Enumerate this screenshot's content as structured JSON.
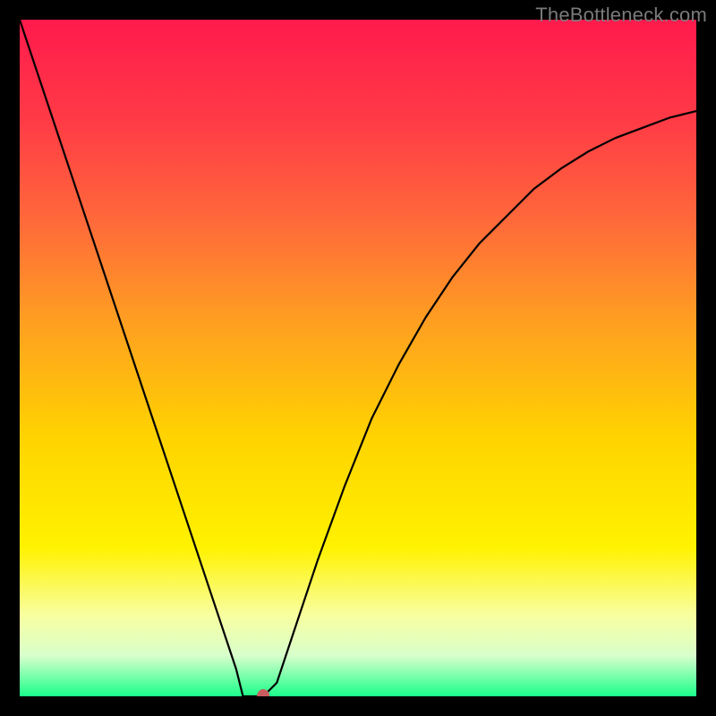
{
  "watermark": "TheBottleneck.com",
  "chart_data": {
    "type": "line",
    "title": "",
    "xlabel": "",
    "ylabel": "",
    "xlim": [
      0,
      100
    ],
    "ylim": [
      0,
      100
    ],
    "background_gradient": {
      "type": "vertical",
      "stops": [
        {
          "pos": 0.0,
          "color": "#ff1a4d"
        },
        {
          "pos": 0.15,
          "color": "#ff3b46"
        },
        {
          "pos": 0.3,
          "color": "#ff6a3a"
        },
        {
          "pos": 0.45,
          "color": "#ffa020"
        },
        {
          "pos": 0.62,
          "color": "#ffd400"
        },
        {
          "pos": 0.78,
          "color": "#fff200"
        },
        {
          "pos": 0.88,
          "color": "#f8ffa0"
        },
        {
          "pos": 0.94,
          "color": "#d8ffcc"
        },
        {
          "pos": 1.0,
          "color": "#1bff8a"
        }
      ]
    },
    "series": [
      {
        "name": "bottleneck-curve",
        "color": "#000000",
        "x": [
          0,
          4,
          8,
          12,
          16,
          20,
          24,
          28,
          32,
          33,
          36,
          38,
          40,
          44,
          48,
          52,
          56,
          60,
          64,
          68,
          72,
          76,
          80,
          84,
          88,
          92,
          96,
          100
        ],
        "y": [
          100,
          88,
          76,
          64,
          52,
          40,
          28,
          16,
          4,
          0,
          0,
          2,
          8,
          20,
          31,
          41,
          49,
          56,
          62,
          67,
          71,
          75,
          78,
          80.5,
          82.5,
          84,
          85.5,
          86.5
        ]
      }
    ],
    "marker": {
      "name": "optimal-point",
      "x": 36,
      "y": 0,
      "color": "#c95d5d",
      "radius_px": 7
    }
  }
}
